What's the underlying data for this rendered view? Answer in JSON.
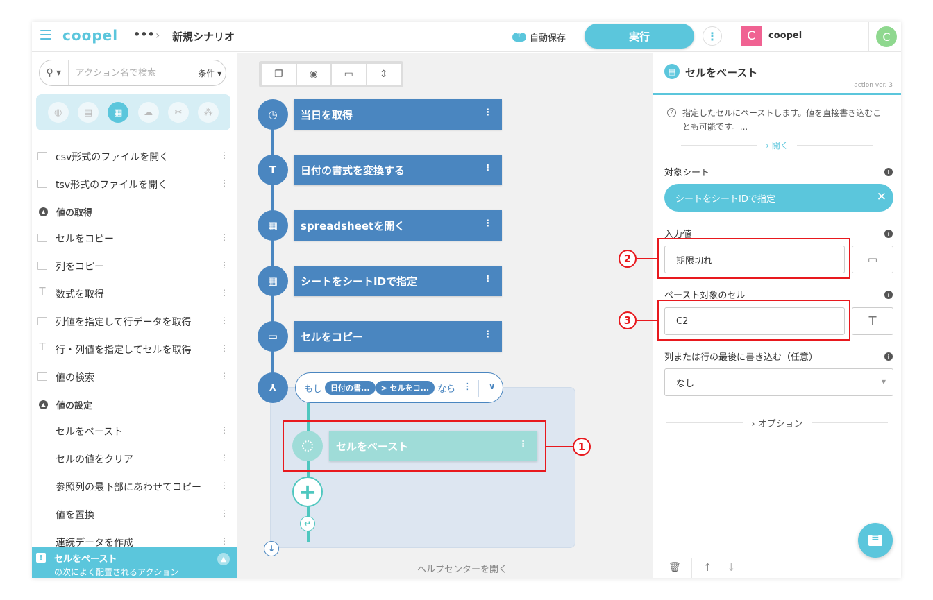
{
  "header": {
    "logo": "coopel",
    "breadcrumb_more": "•••",
    "breadcrumb_chevron": "›",
    "scenario_title": "新規シナリオ",
    "autosave_label": "自動保存",
    "run_label": "実行",
    "more_label": "⋮",
    "org_avatar_letter": "C",
    "org_name": "coopel",
    "user_avatar_letter": "C"
  },
  "sidebar": {
    "search_placeholder": "アクション名で検索",
    "filter_label": "条件 ▾",
    "categories": [
      {
        "icon": "globe-icon",
        "glyph": "◍",
        "active": false
      },
      {
        "icon": "excel-icon",
        "glyph": "▤",
        "active": false
      },
      {
        "icon": "spreadsheet-doc-icon",
        "glyph": "▦",
        "active": true
      },
      {
        "icon": "cloud-icon",
        "glyph": "☁",
        "active": false
      },
      {
        "icon": "tools-icon",
        "glyph": "✂",
        "active": false
      },
      {
        "icon": "blocks-icon",
        "glyph": "⁂",
        "active": false
      }
    ],
    "items_top": [
      {
        "label": "csv形式のファイルを開く"
      },
      {
        "label": "tsv形式のファイルを開く"
      }
    ],
    "section_get": "値の取得",
    "items_get": [
      {
        "label": "セルをコピー",
        "icon": "cell"
      },
      {
        "label": "列をコピー",
        "icon": "cell"
      },
      {
        "label": "数式を取得",
        "icon": "text"
      },
      {
        "label": "列値を指定して行データを取得",
        "icon": "cell"
      },
      {
        "label": "行・列値を指定してセルを取得",
        "icon": "text"
      },
      {
        "label": "値の検索",
        "icon": "cell"
      }
    ],
    "section_set": "値の設定",
    "items_set": [
      {
        "label": "セルをペースト"
      },
      {
        "label": "セルの値をクリア"
      },
      {
        "label": "参照列の最下部にあわせてコピー"
      },
      {
        "label": "値を置換"
      },
      {
        "label": "連続データを作成"
      }
    ],
    "banner": {
      "title": "セルをペースト",
      "subtitle": "の次によく配置されるアクション"
    }
  },
  "canvas": {
    "nodes": [
      {
        "label": "当日を取得",
        "glyph": "◷"
      },
      {
        "label": "日付の書式を変換する",
        "glyph": "T"
      },
      {
        "label": "spreadsheetを開く",
        "glyph": "▦"
      },
      {
        "label": "シートをシートIDで指定",
        "glyph": "▦"
      },
      {
        "label": "セルをコピー",
        "glyph": "▭"
      }
    ],
    "condition": {
      "prefix": "もし",
      "chip1": "日付の書...",
      "chip2": "> セルをコ...",
      "suffix": "なら"
    },
    "branch_node_label": "セルをペースト",
    "help_link": "ヘルプセンターを開く",
    "callouts": {
      "one": "1",
      "two": "2",
      "three": "3"
    }
  },
  "panel": {
    "title": "セルをペースト",
    "version": "action ver. 3",
    "description": "指定したセルにペーストします。値を直接書き込むことも可能です。...",
    "open_label": "› 開く",
    "target_sheet_label": "対象シート",
    "target_sheet_value": "シートをシートIDで指定",
    "input_value_label": "入力値",
    "input_value": "期限切れ",
    "paste_cell_label": "ペースト対象のセル",
    "paste_cell_value": "C2",
    "append_label": "列または行の最後に書き込む（任意）",
    "append_value": "なし",
    "options_label": "› オプション"
  }
}
